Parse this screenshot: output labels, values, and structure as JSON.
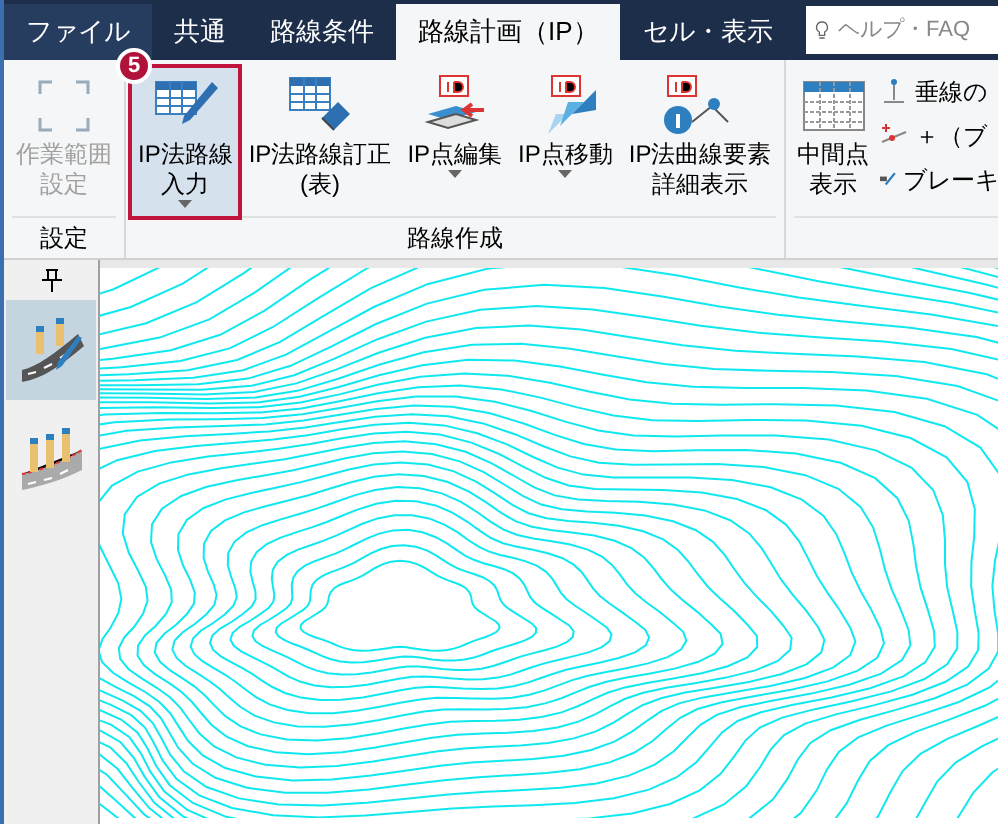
{
  "tabs": [
    {
      "label": "ファイル",
      "selected": false,
      "kind": "file"
    },
    {
      "label": "共通",
      "selected": false,
      "kind": "tab"
    },
    {
      "label": "路線条件",
      "selected": false,
      "kind": "tab"
    },
    {
      "label": "路線計画（IP）",
      "selected": true,
      "kind": "tab"
    },
    {
      "label": "セル・表示",
      "selected": false,
      "kind": "tab"
    }
  ],
  "search": {
    "placeholder": "ヘルプ・FAQ"
  },
  "ribbon_groups": [
    {
      "label": "設定",
      "buttons": [
        {
          "lines": [
            "作業範囲",
            "設定"
          ],
          "kind": "range",
          "disabled": true,
          "dropdown": false,
          "highlighted": false
        }
      ]
    },
    {
      "label": "路線作成",
      "buttons": [
        {
          "lines": [
            "IP法路線",
            "入力"
          ],
          "kind": "table-pen",
          "disabled": false,
          "dropdown": true,
          "highlighted": true,
          "badge": "5"
        },
        {
          "lines": [
            "IP法路線訂正",
            "(表)"
          ],
          "kind": "table-eraser",
          "disabled": false,
          "dropdown": false,
          "highlighted": false
        },
        {
          "lines": [
            "IP点編集"
          ],
          "kind": "ip-edit",
          "disabled": false,
          "dropdown": true,
          "highlighted": false
        },
        {
          "lines": [
            "IP点移動"
          ],
          "kind": "ip-move",
          "disabled": false,
          "dropdown": true,
          "highlighted": false
        },
        {
          "lines": [
            "IP法曲線要素",
            "詳細表示"
          ],
          "kind": "ip-info",
          "disabled": false,
          "dropdown": false,
          "highlighted": false
        }
      ]
    },
    {
      "buttons": [
        {
          "lines": [
            "中間点",
            "表示"
          ],
          "kind": "grid",
          "disabled": false,
          "dropdown": false,
          "highlighted": false
        }
      ],
      "small_items": [
        "垂線の",
        "＋（ブ",
        "ブレーキ"
      ]
    }
  ],
  "sidebar": {
    "items": [
      {
        "selected": true,
        "kind": "road-edit"
      },
      {
        "selected": false,
        "kind": "road"
      }
    ]
  }
}
